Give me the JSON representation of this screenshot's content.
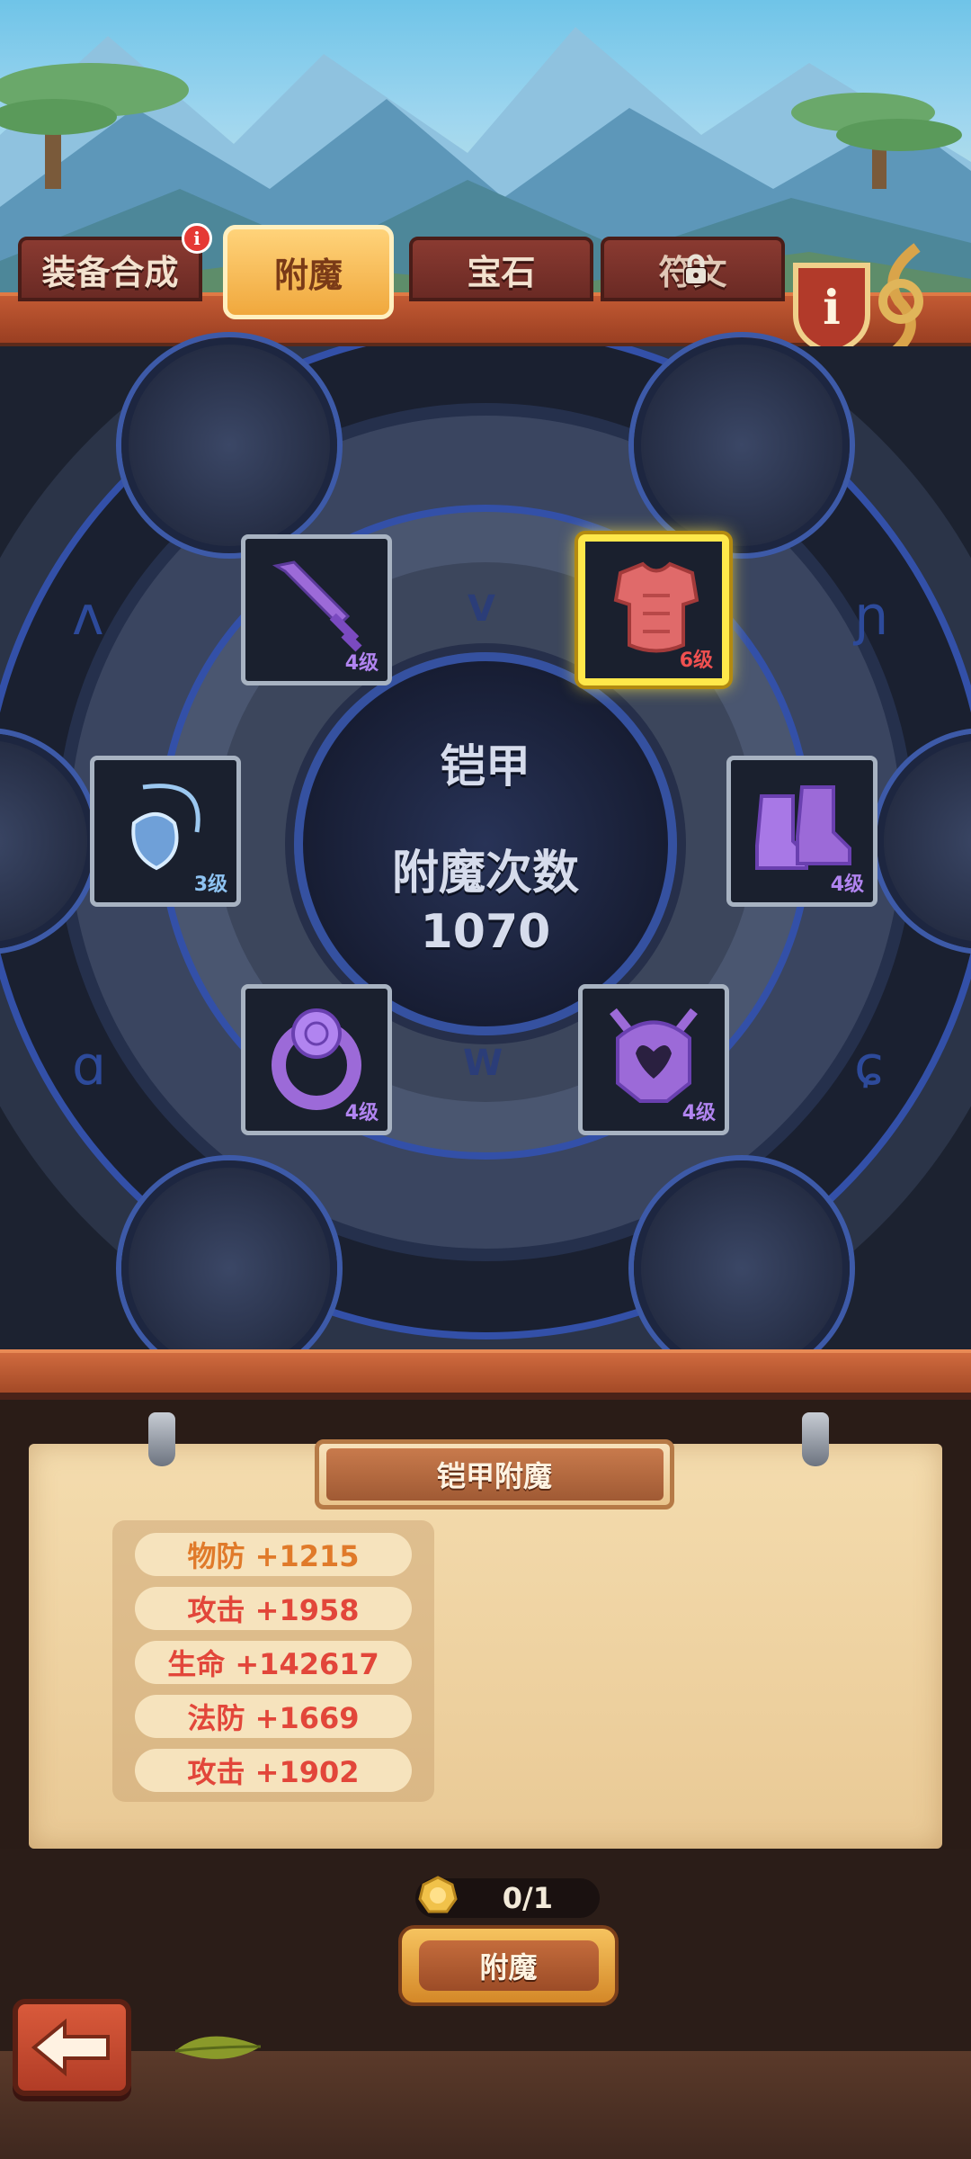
{
  "tabs": [
    {
      "label": "装备合成",
      "has_badge": true,
      "badge": "i"
    },
    {
      "label": "附魔",
      "active": true
    },
    {
      "label": "宝石"
    },
    {
      "label": "符文",
      "locked": true
    }
  ],
  "info_button": {
    "icon": "info-icon",
    "label": "i"
  },
  "center": {
    "equipment_name": "铠甲",
    "count_label": "附魔次数",
    "count_value": "1070"
  },
  "slots": [
    {
      "name": "sword",
      "icon": "sword-icon",
      "level": "4级",
      "color": "#9c6ad8",
      "selected": false
    },
    {
      "name": "armor",
      "icon": "armor-icon",
      "level": "6级",
      "color": "#e35a5a",
      "selected": true
    },
    {
      "name": "amulet",
      "icon": "amulet-icon",
      "level": "3级",
      "color": "#7fb6e8",
      "selected": false
    },
    {
      "name": "boots",
      "icon": "boots-icon",
      "level": "4级",
      "color": "#9c6ad8",
      "selected": false
    },
    {
      "name": "ring",
      "icon": "ring-icon",
      "level": "4级",
      "color": "#9c6ad8",
      "selected": false
    },
    {
      "name": "helmet",
      "icon": "helmet-icon",
      "level": "4级",
      "color": "#9c6ad8",
      "selected": false
    }
  ],
  "panel": {
    "title": "铠甲附魔",
    "stats": [
      {
        "text": "物防 +1215",
        "color": "#e07a2a"
      },
      {
        "text": "攻击 +1958",
        "color": "#e2463a"
      },
      {
        "text": "生命 +142617",
        "color": "#e2463a"
      },
      {
        "text": "法防 +1669",
        "color": "#e2463a"
      },
      {
        "text": "攻击 +1902",
        "color": "#e2463a"
      }
    ]
  },
  "cost": {
    "icon": "gold-coin-icon",
    "value": "0/1"
  },
  "enchant_button": {
    "label": "附魔"
  },
  "back_button": {
    "icon": "back-arrow-icon"
  }
}
